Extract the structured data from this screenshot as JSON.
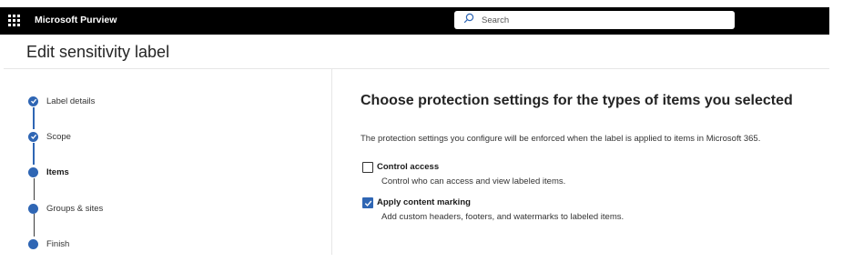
{
  "header": {
    "app_name": "Microsoft Purview",
    "search_placeholder": "Search"
  },
  "page": {
    "title": "Edit sensitivity label"
  },
  "wizard": {
    "steps": [
      {
        "label": "Label details",
        "status": "completed"
      },
      {
        "label": "Scope",
        "status": "completed"
      },
      {
        "label": "Items",
        "status": "current"
      },
      {
        "label": "Groups & sites",
        "status": "pending"
      },
      {
        "label": "Finish",
        "status": "pending"
      }
    ]
  },
  "main": {
    "heading": "Choose protection settings for the types of items you selected",
    "description": "The protection settings you configure will be enforced when the label is applied to items in Microsoft 365.",
    "options": [
      {
        "label": "Control access",
        "description": "Control who can access and view labeled items.",
        "checked": false
      },
      {
        "label": "Apply content marking",
        "description": "Add custom headers, footers, and watermarks to labeled items.",
        "checked": true
      }
    ]
  },
  "colors": {
    "accent": "#2f66b4",
    "topbar": "#000000"
  }
}
